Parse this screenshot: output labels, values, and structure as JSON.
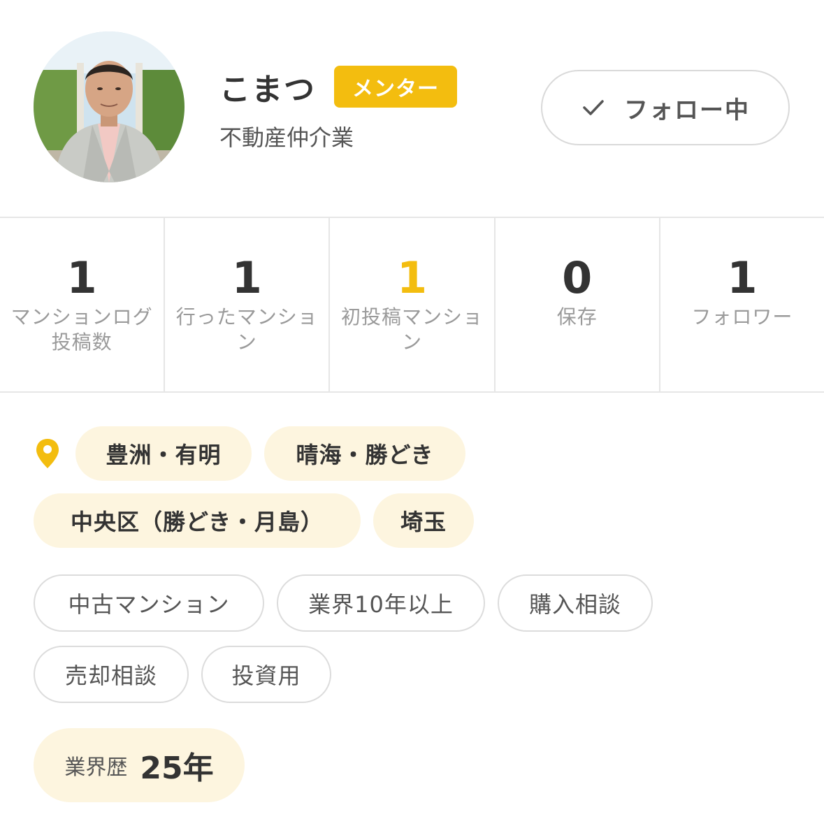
{
  "profile": {
    "name": "こまつ",
    "badge": "メンター",
    "occupation": "不動産仲介業",
    "follow_label": "フォロー中"
  },
  "stats": [
    {
      "value": "1",
      "label": "マンションログ投稿数"
    },
    {
      "value": "1",
      "label": "行ったマンション"
    },
    {
      "value": "1",
      "label": "初投稿マンション"
    },
    {
      "value": "0",
      "label": "保存"
    },
    {
      "value": "1",
      "label": "フォロワー"
    }
  ],
  "areas": [
    "豊洲・有明",
    "晴海・勝どき",
    "中央区（勝どき・月島）",
    "埼玉"
  ],
  "tags": [
    "中古マンション",
    "業界10年以上",
    "購入相談",
    "売却相談",
    "投資用"
  ],
  "experience": {
    "label": "業界歴",
    "value": "25年"
  },
  "colors": {
    "accent": "#f3bd0f",
    "chip_bg": "#fdf5df",
    "border": "#e6e6e6"
  },
  "icons": {
    "check": "check-icon",
    "location": "map-pin-icon"
  }
}
